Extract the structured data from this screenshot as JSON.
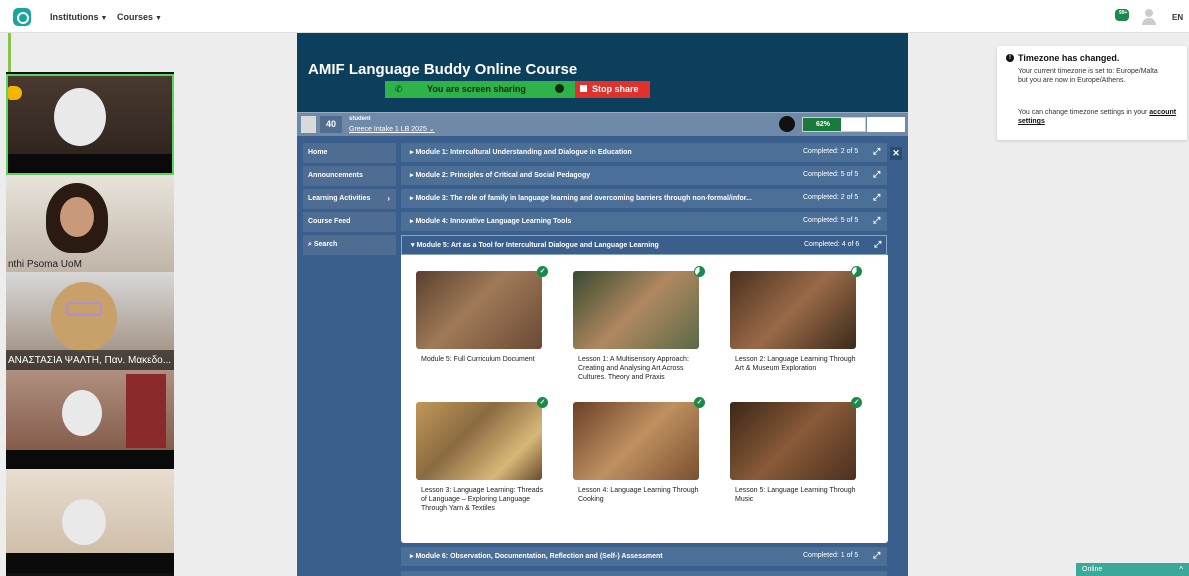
{
  "topbar": {
    "nav": [
      "Institutions",
      "Courses"
    ],
    "chat_badge": "99+",
    "language": "EN"
  },
  "participants": [
    {
      "name": ""
    },
    {
      "name": "nthi Psoma UoM"
    },
    {
      "name": "ΑΝΑΣΤΑΣΙΑ ΨΑΛΤΗ, Παν. Μακεδο..."
    },
    {
      "name": ""
    },
    {
      "name": ""
    }
  ],
  "course": {
    "title": "AMIF Language Buddy Online Course",
    "screen_share_text": "You are screen sharing",
    "stop_share_label": "Stop share",
    "points": "40",
    "role": "student",
    "group": "Greece Intake 1 LB 2025",
    "progress_label": "62%",
    "progress_value": 0.62
  },
  "course_nav": [
    "Home",
    "Announcements",
    "Learning Activities",
    "Course Feed",
    "Search"
  ],
  "modules": [
    {
      "title": "Module 1: Intercultural Understanding and Dialogue in Education",
      "completed": "Completed: 2 of 5"
    },
    {
      "title": "Module 2: Principles of Critical and Social Pedagogy",
      "completed": "Completed: 5 of 5"
    },
    {
      "title": "Module 3: The role of family in language learning and overcoming barriers through non-formal/infor...",
      "completed": "Completed: 2 of 5"
    },
    {
      "title": "Module 4: Innovative Language Learning Tools",
      "completed": "Completed: 5 of 5"
    },
    {
      "title": "Module 5: Art as a Tool for Intercultural Dialogue and Language Learning",
      "completed": "Completed: 4 of 6"
    },
    {
      "title": "Module 6: Observation, Documentation, Reflection and (Self-) Assessment",
      "completed": "Completed: 1 of 5"
    }
  ],
  "lessons": [
    {
      "title": "Module 5: Full Curriculum Document",
      "status": "complete"
    },
    {
      "title": "Lesson 1: A Multisensory Approach: Creating and Analysing Art Across Cultures. Theory and Praxis",
      "status": "partial"
    },
    {
      "title": "Lesson 2: Language Learning Through Art & Museum Exploration",
      "status": "partial"
    },
    {
      "title": "Lesson 3: Language Learning: Threads of Language – Exploring Language Through Yarn & Textiles",
      "status": "complete"
    },
    {
      "title": "Lesson 4: Language Learning Through Cooking",
      "status": "complete"
    },
    {
      "title": "Lesson 5: Language Learning Through Music",
      "status": "complete"
    }
  ],
  "timezone": {
    "title": "Timezone has changed.",
    "body": "Your current timezone is set to: Europe/Malta but you are now in Europe/Athens.",
    "body2": "You can change timezone settings in your",
    "link": "account settings"
  },
  "online_label": "Online"
}
